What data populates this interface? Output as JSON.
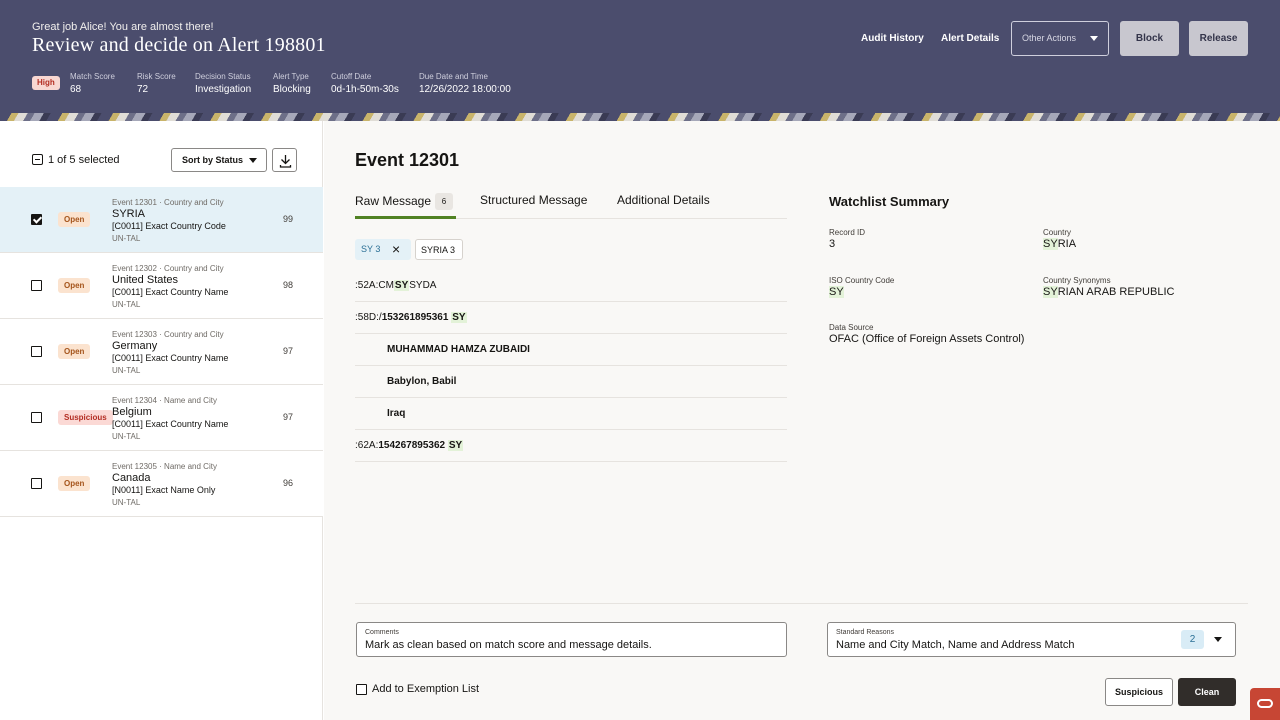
{
  "header": {
    "greeting": "Great job Alice! You are almost there!",
    "title": "Review and decide on Alert 198801",
    "priority": "High",
    "meta": [
      {
        "label": "Match Score",
        "value": "68"
      },
      {
        "label": "Risk Score",
        "value": "72"
      },
      {
        "label": "Decision Status",
        "value": "Investigation"
      },
      {
        "label": "Alert Type",
        "value": "Blocking"
      },
      {
        "label": "Cutoff Date",
        "value": "0d-1h-50m-30s"
      },
      {
        "label": "Due Date and Time",
        "value": "12/26/2022 18:00:00"
      }
    ],
    "links": {
      "audit": "Audit History",
      "details": "Alert Details"
    },
    "other_actions": "Other Actions",
    "block": "Block",
    "release": "Release"
  },
  "list": {
    "selected_text": "1 of 5 selected",
    "sort_label": "Sort by Status",
    "rows": [
      {
        "status": "Open",
        "meta": "Event 12301 · Country and City",
        "name": "SYRIA",
        "code": "[C0011] Exact Country Code",
        "sub": "UN-TAL",
        "score": "99",
        "checked": true
      },
      {
        "status": "Open",
        "meta": "Event 12302 · Country and City",
        "name": "United States",
        "code": "[C0011] Exact Country Name",
        "sub": "UN-TAL",
        "score": "98",
        "checked": false
      },
      {
        "status": "Open",
        "meta": "Event 12303 · Country and City",
        "name": "Germany",
        "code": "[C0011] Exact Country Name",
        "sub": "UN-TAL",
        "score": "97",
        "checked": false
      },
      {
        "status": "Suspicious",
        "meta": "Event 12304 · Name and City",
        "name": "Belgium",
        "code": "[C0011] Exact Country Name",
        "sub": "UN-TAL",
        "score": "97",
        "checked": false
      },
      {
        "status": "Open",
        "meta": "Event 12305 · Name and City",
        "name": "Canada",
        "code": "[N0011] Exact Name Only",
        "sub": "UN-TAL",
        "score": "96",
        "checked": false
      }
    ]
  },
  "event": {
    "title": "Event 12301",
    "tabs": [
      {
        "label": "Raw Message",
        "count": "6"
      },
      {
        "label": "Structured Message"
      },
      {
        "label": "Additional Details"
      }
    ],
    "chips": [
      {
        "label": "SY 3"
      },
      {
        "label": "SYRIA 3"
      }
    ],
    "lines": [
      {
        "pre": ":52A:CM",
        "hl": "SY",
        "post": "SYDA"
      },
      {
        "pre": ":58D:/",
        "bold": "153261895361",
        "hl": "SY"
      },
      {
        "text": "MUHAMMAD HAMZA ZUBAIDI"
      },
      {
        "text": "Babylon, Babil"
      },
      {
        "text": "Iraq"
      },
      {
        "pre": ":62A:",
        "bold": "154267895362",
        "hl": "SY"
      }
    ]
  },
  "watchlist": {
    "title": "Watchlist Summary",
    "record_id": {
      "label": "Record ID",
      "value": "3"
    },
    "country": {
      "label": "Country",
      "hl": "SY",
      "rest": "RIA"
    },
    "iso": {
      "label": "ISO Country Code",
      "hl": "SY",
      "rest": ""
    },
    "synonyms": {
      "label": "Country Synonyms",
      "hl": "SY",
      "rest": "RIAN ARAB REPUBLIC"
    },
    "source": {
      "label": "Data Source",
      "value": "OFAC (Office of Foreign Assets Control)"
    }
  },
  "form": {
    "comments_label": "Comments",
    "comments_value": "Mark as clean based on match score and message details.",
    "reasons_label": "Standard Reasons",
    "reasons_value": "Name and City Match, Name and Address Match",
    "reasons_count": "2",
    "exemption_label": "Add to Exemption List",
    "suspicious": "Suspicious",
    "clean": "Clean"
  },
  "colors": {
    "header_bg": "#4b4d6d",
    "accent_green": "#508223",
    "highlight": "#e3f2d8",
    "selected_row": "#e4f1f7"
  }
}
